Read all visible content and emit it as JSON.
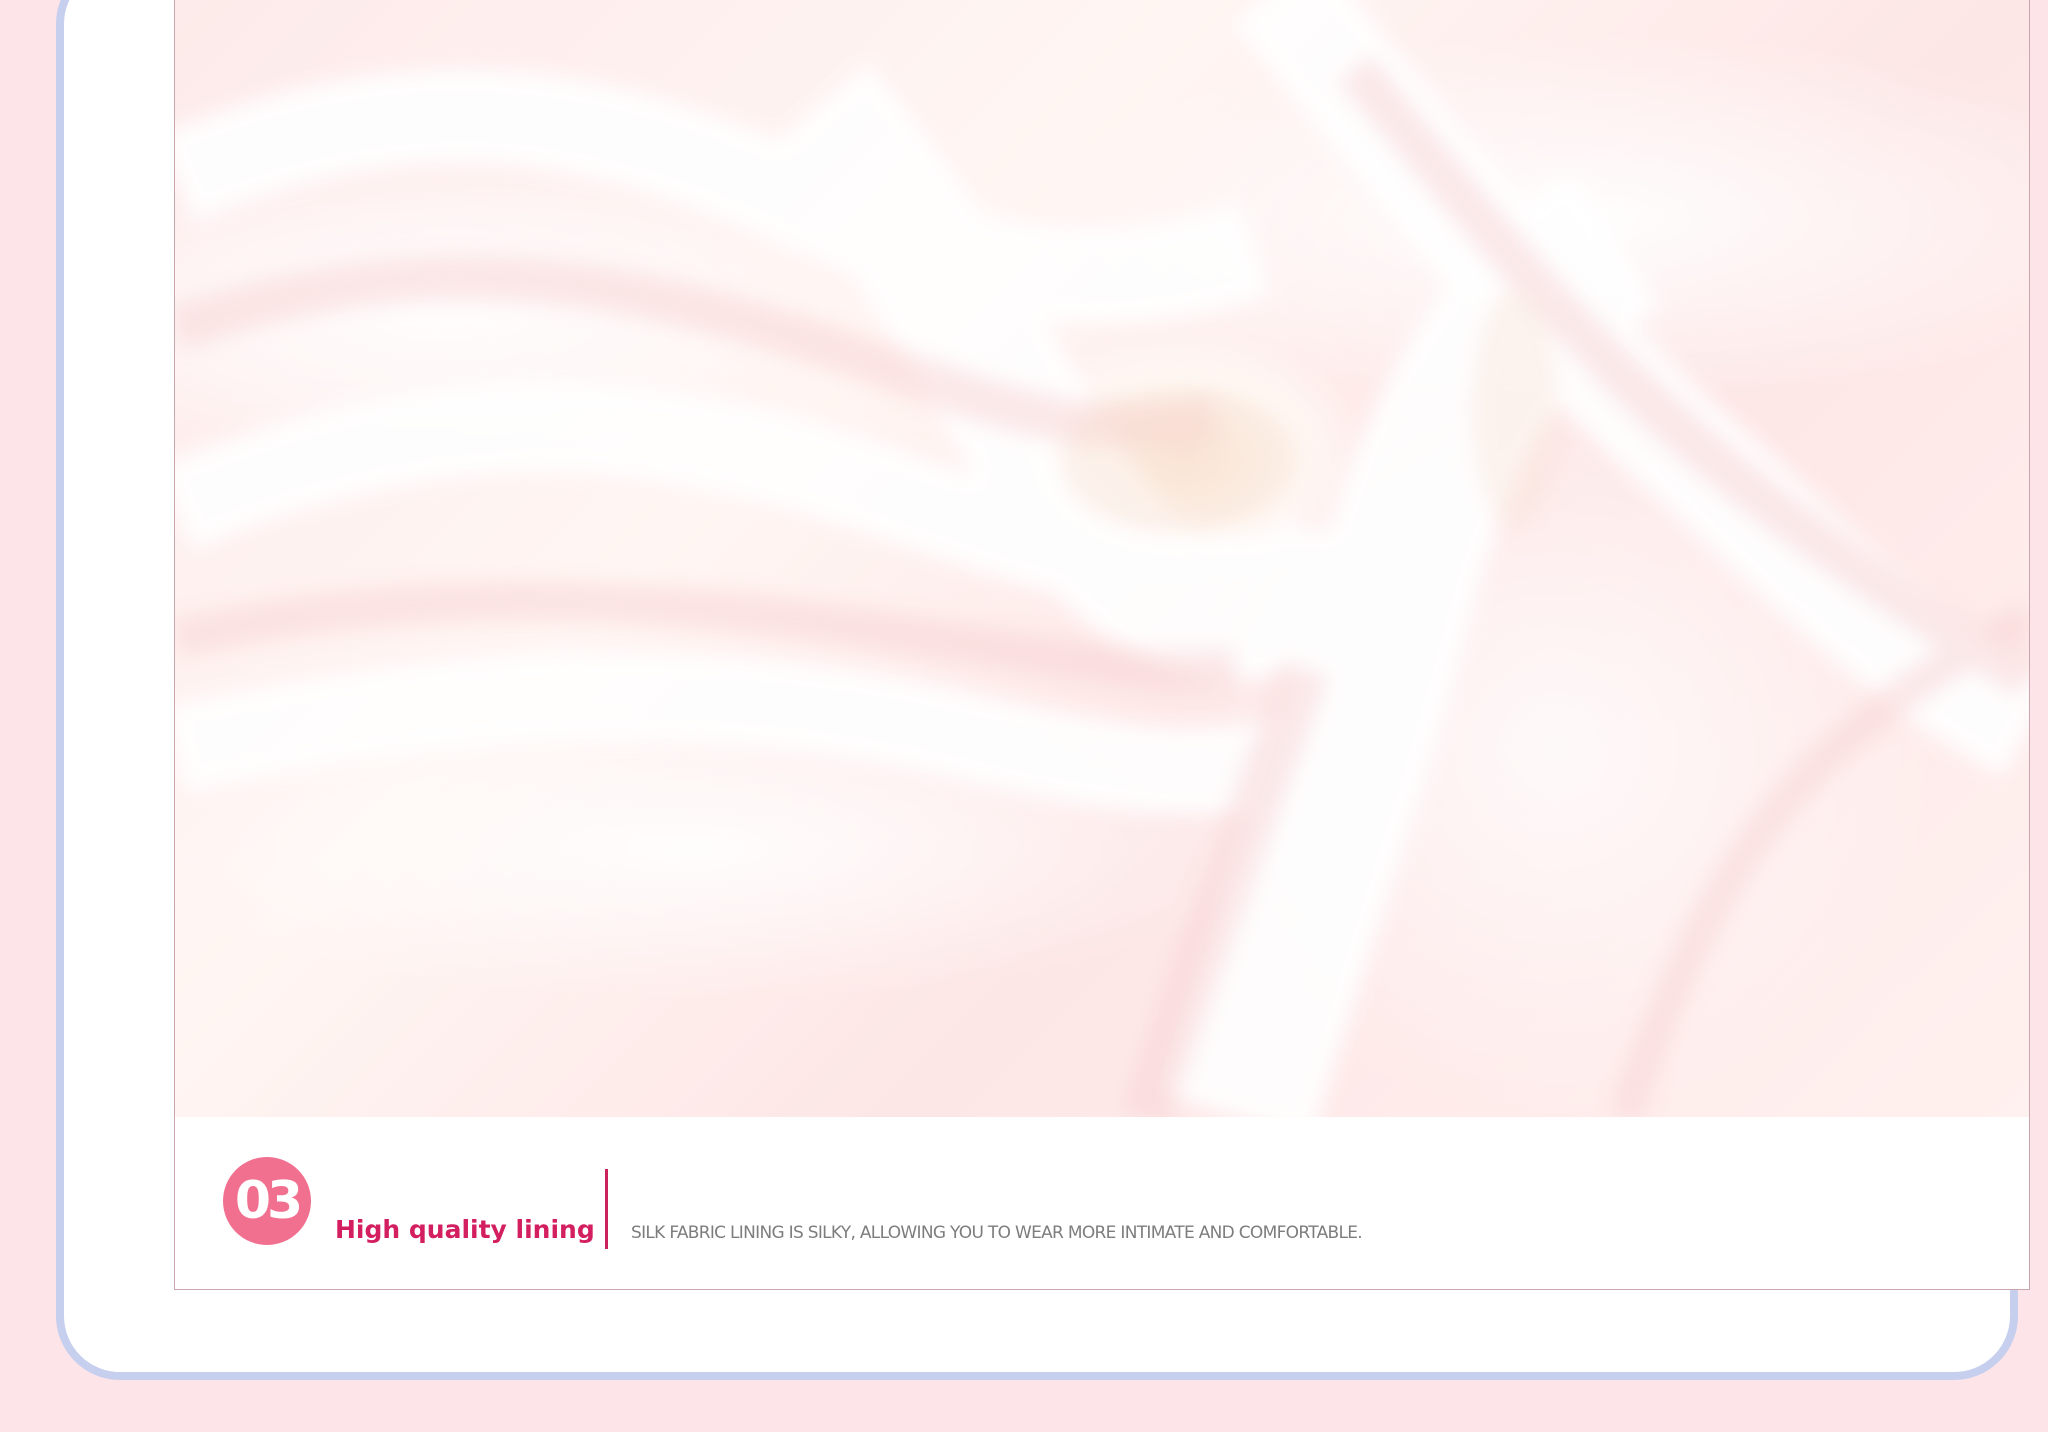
{
  "feature": {
    "number": "03",
    "title": "High quality lining",
    "description": "SILK FABRIC LINING IS SILKY, ALLOWING YOU TO WEAR MORE INTIMATE AND COMFORTABLE."
  },
  "colors": {
    "page_background": "#fde4e8",
    "card_border": "#c6cfee",
    "badge": "#f16f8f",
    "title": "#d31f5f",
    "description": "#7d7d7d"
  }
}
